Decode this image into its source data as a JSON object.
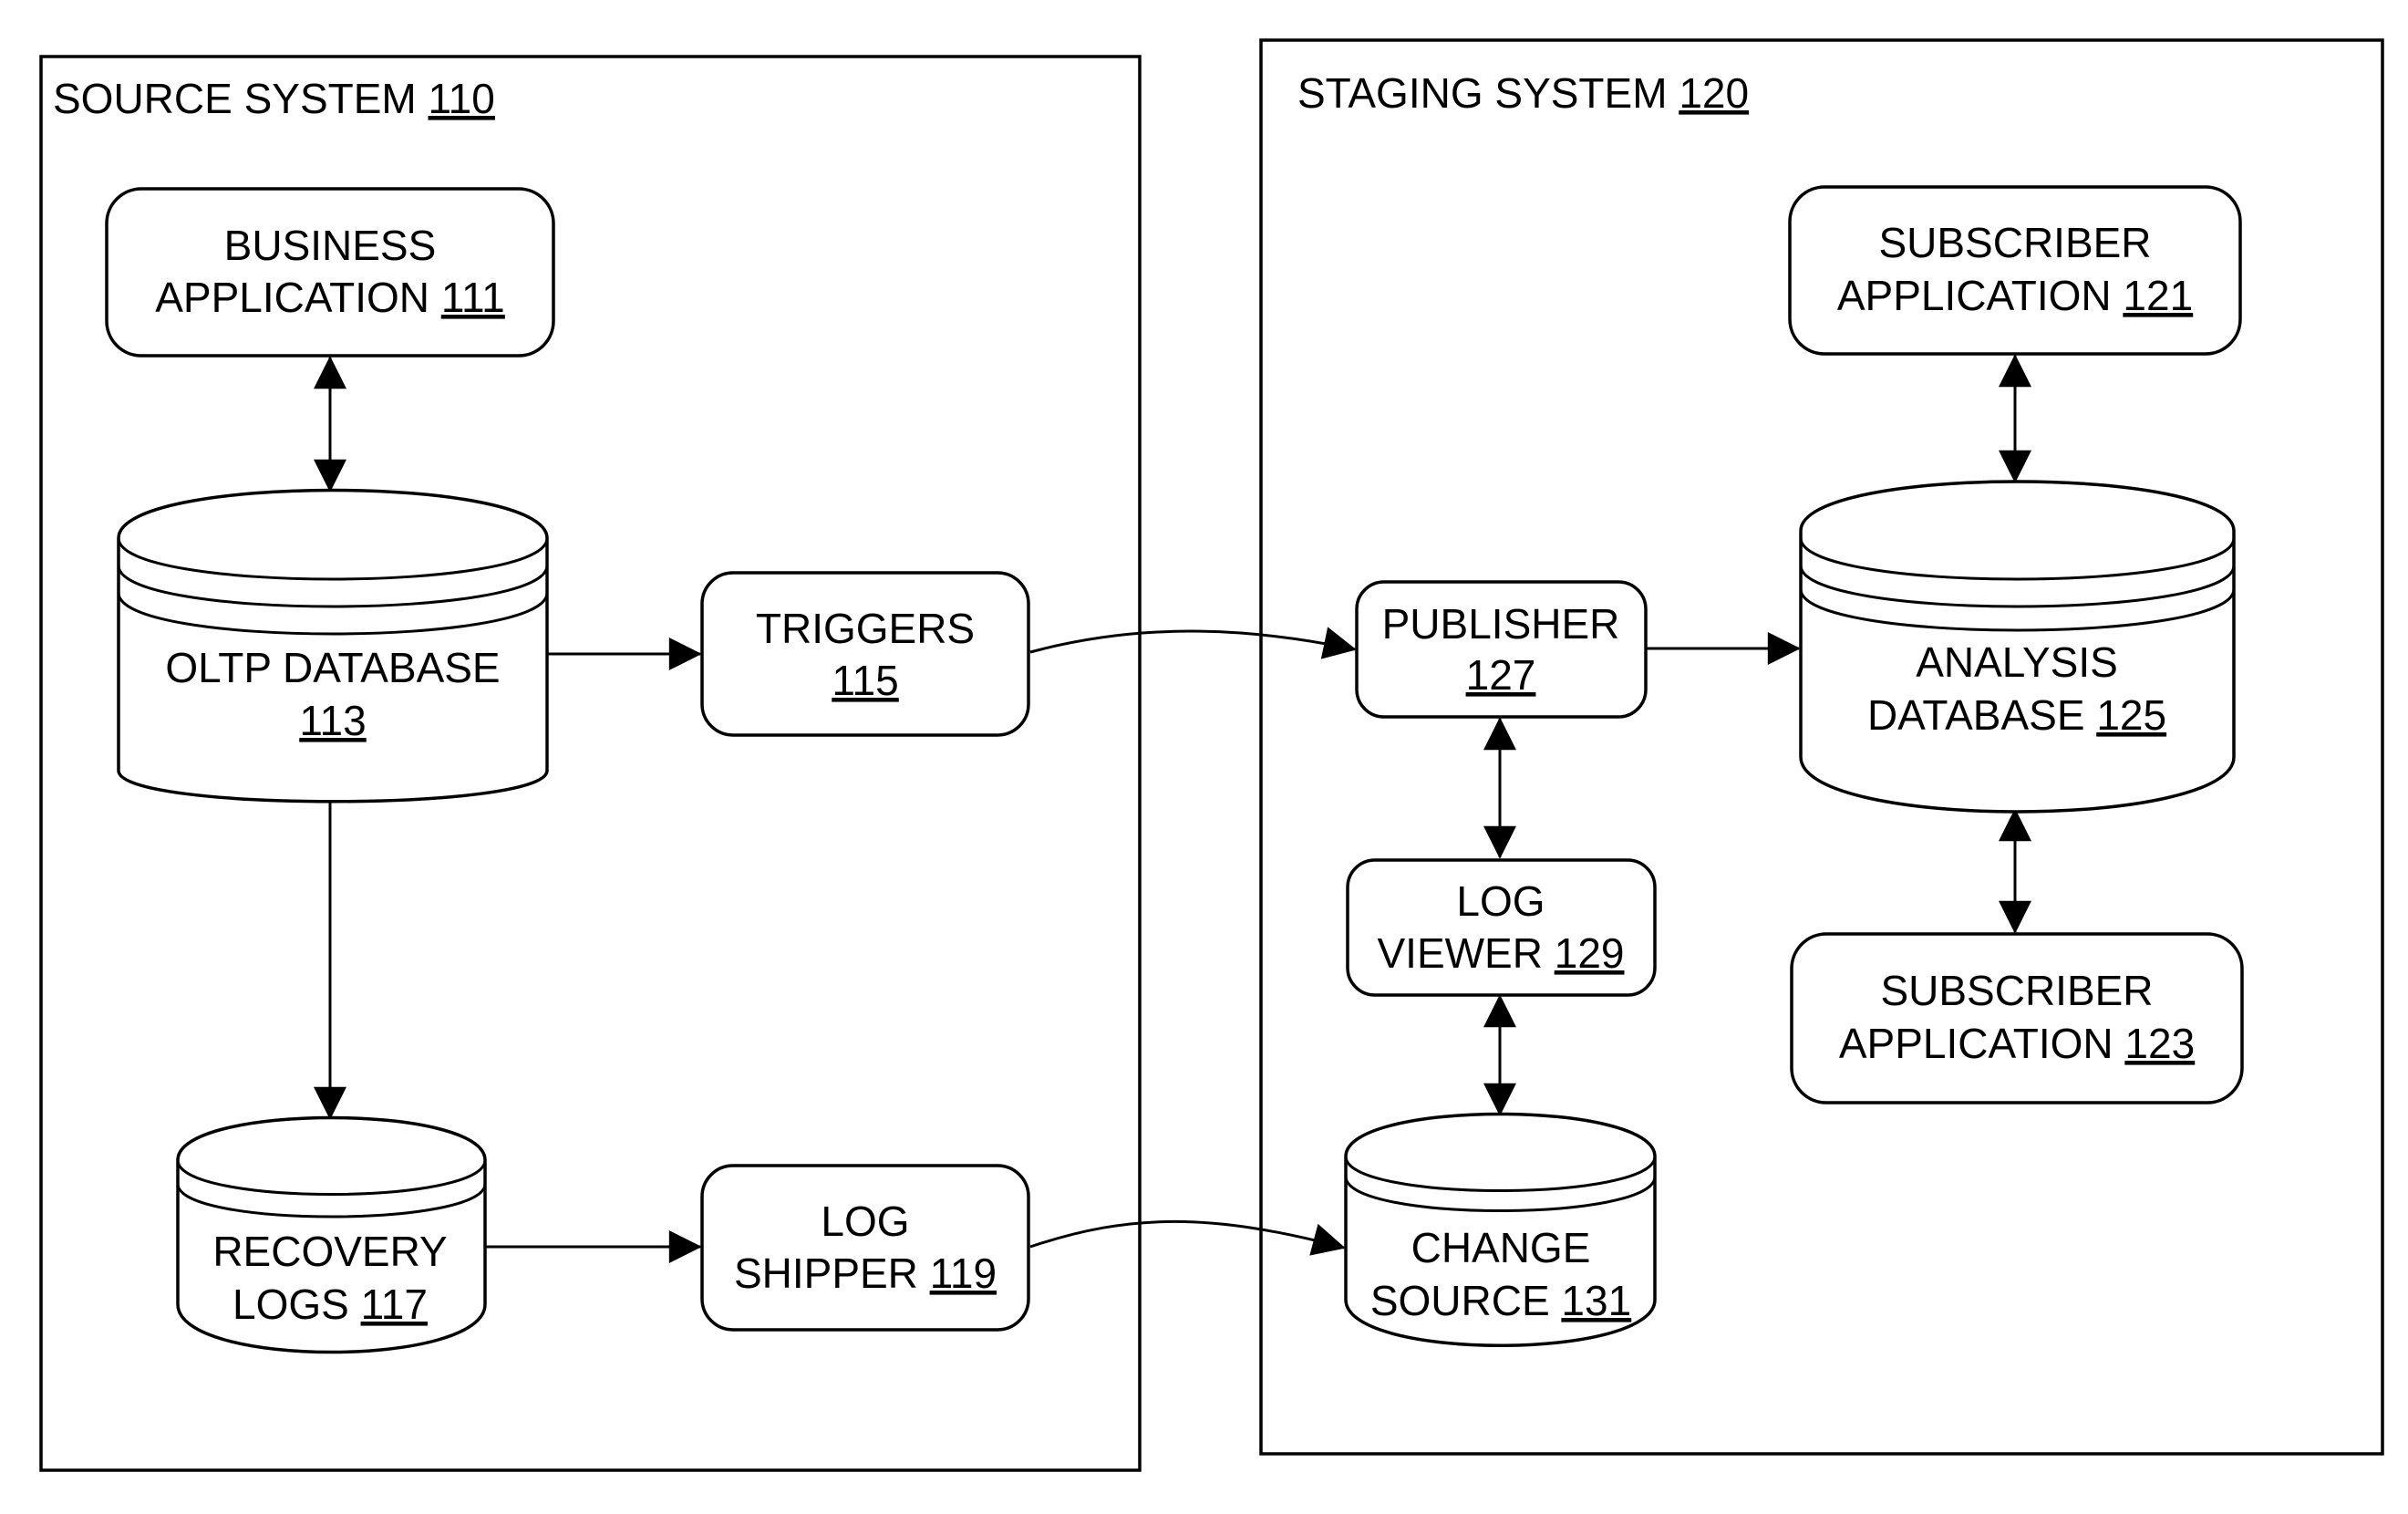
{
  "systems": {
    "source": {
      "title": "SOURCE SYSTEM",
      "ref": "110"
    },
    "staging": {
      "title": "STAGING SYSTEM",
      "ref": "120"
    }
  },
  "nodes": {
    "business_app": {
      "line1": "BUSINESS",
      "line2": "APPLICATION",
      "ref": "111",
      "shape": "rounded-rect"
    },
    "oltp_db": {
      "line1": "OLTP DATABASE",
      "line2": "",
      "ref": "113",
      "shape": "cylinder"
    },
    "triggers": {
      "line1": "TRIGGERS",
      "line2": "",
      "ref": "115",
      "shape": "rounded-rect"
    },
    "recovery_logs": {
      "line1": "RECOVERY",
      "line2": "LOGS",
      "ref": "117",
      "shape": "cylinder"
    },
    "log_shipper": {
      "line1": "LOG",
      "line2": "SHIPPER",
      "ref": "119",
      "shape": "rounded-rect"
    },
    "sub_app_121": {
      "line1": "SUBSCRIBER",
      "line2": "APPLICATION",
      "ref": "121",
      "shape": "rounded-rect"
    },
    "sub_app_123": {
      "line1": "SUBSCRIBER",
      "line2": "APPLICATION",
      "ref": "123",
      "shape": "rounded-rect"
    },
    "analysis_db": {
      "line1": "ANALYSIS",
      "line2": "DATABASE",
      "ref": "125",
      "shape": "cylinder"
    },
    "publisher": {
      "line1": "PUBLISHER",
      "line2": "",
      "ref": "127",
      "shape": "rounded-rect"
    },
    "log_viewer": {
      "line1": "LOG",
      "line2": "VIEWER",
      "ref": "129",
      "shape": "rounded-rect"
    },
    "change_source": {
      "line1": "CHANGE",
      "line2": "SOURCE",
      "ref": "131",
      "shape": "cylinder"
    }
  },
  "edges": [
    {
      "from": "business_app",
      "to": "oltp_db",
      "direction": "bidirectional"
    },
    {
      "from": "oltp_db",
      "to": "triggers",
      "direction": "forward"
    },
    {
      "from": "oltp_db",
      "to": "recovery_logs",
      "direction": "forward"
    },
    {
      "from": "recovery_logs",
      "to": "log_shipper",
      "direction": "forward"
    },
    {
      "from": "triggers",
      "to": "publisher",
      "direction": "forward"
    },
    {
      "from": "log_shipper",
      "to": "change_source",
      "direction": "forward"
    },
    {
      "from": "publisher",
      "to": "analysis_db",
      "direction": "forward"
    },
    {
      "from": "sub_app_121",
      "to": "analysis_db",
      "direction": "bidirectional"
    },
    {
      "from": "analysis_db",
      "to": "sub_app_123",
      "direction": "bidirectional"
    },
    {
      "from": "publisher",
      "to": "log_viewer",
      "direction": "bidirectional"
    },
    {
      "from": "log_viewer",
      "to": "change_source",
      "direction": "bidirectional"
    }
  ]
}
